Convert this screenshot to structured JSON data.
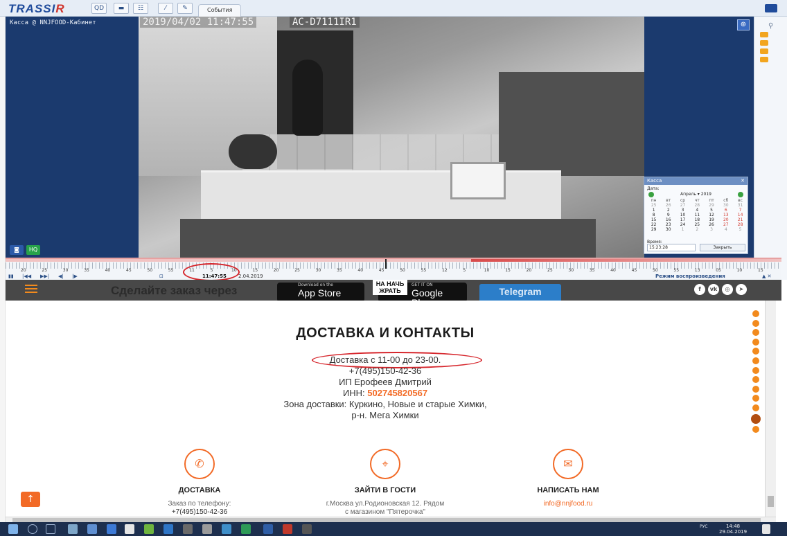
{
  "trassir": {
    "logo_main": "TRASSI",
    "logo_r": "R",
    "toolbar_buttons": [
      "QD",
      "▬",
      "☷",
      "⁄",
      "✎"
    ],
    "events_tab": "События",
    "camera_name": "Касса @ NNJFOOD-Кабинет",
    "osd_datetime": "2019/04/02 11:47:55",
    "osd_camera": "AC-D7111IR1",
    "zoom_icon": "zoom-in-icon",
    "hq_label": "HQ",
    "calendar": {
      "title": "Касса",
      "date_label": "Дата:",
      "month": "Апрель",
      "year": "2019",
      "weekdays": [
        "пн",
        "вт",
        "ср",
        "чт",
        "пт",
        "сб",
        "вс"
      ],
      "weeks": [
        [
          "25",
          "26",
          "27",
          "28",
          "29",
          "30",
          "31"
        ],
        [
          "1",
          "2",
          "3",
          "4",
          "5",
          "6",
          "7"
        ],
        [
          "8",
          "9",
          "10",
          "11",
          "12",
          "13",
          "14"
        ],
        [
          "15",
          "16",
          "17",
          "18",
          "19",
          "20",
          "21"
        ],
        [
          "22",
          "23",
          "24",
          "25",
          "26",
          "27",
          "28"
        ],
        [
          "29",
          "30",
          "1",
          "2",
          "3",
          "4",
          "5"
        ]
      ],
      "time_label": "Время:",
      "time_value": "15:23:28",
      "close_button": "Закрыть"
    },
    "timeline": {
      "tick_labels": [
        "20",
        "25",
        "30",
        "35",
        "40",
        "45",
        "50",
        "55",
        "11",
        "5",
        "10",
        "15",
        "20",
        "25",
        "30",
        "35",
        "40",
        "45",
        "50",
        "55",
        "12",
        "5",
        "10",
        "15",
        "20",
        "25",
        "30",
        "35",
        "40",
        "45",
        "50",
        "55",
        "13",
        "05",
        "10",
        "15"
      ],
      "current_time": "11:47:55",
      "date": "2.04.2019",
      "playback_mode": "Режим воспроизведения",
      "controls": [
        "▮▮",
        "|◀◀",
        "▶▶|",
        "◀|",
        "|▶"
      ]
    }
  },
  "banner": {
    "text": "Сделайте заказ через",
    "appstore_small": "Download on the",
    "appstore_big": "App Store",
    "logo_text": "НА НАЧЬ ЖРАТЬ",
    "google_small": "GET IT ON",
    "google_big": "Google Play",
    "telegram": "Telegram",
    "socials": [
      "f",
      "vk",
      "ig",
      "tg"
    ]
  },
  "page": {
    "title": "ДОСТАВКА И КОНТАКТЫ",
    "delivery_hours": "Доставка с 11-00 до 23-00.",
    "phone": "+7(495)150-42-36",
    "ip_name": "ИП Ерофеев Дмитрий",
    "inn_label": "ИНН:",
    "inn_value": "502745820567",
    "zone_line1": "Зона доставки: Куркино, Новые и старые Химки,",
    "zone_line2": "р-н. Мега Химки",
    "features": [
      {
        "title": "ДОСТАВКА",
        "line1": "Заказ по телефону:",
        "line2": "+7(495)150-42-36",
        "icon": "phone-icon"
      },
      {
        "title": "ЗАЙТИ В ГОСТИ",
        "line1": "г.Москва ул.Родионовская 12. Рядом",
        "line2": "с магазином \"Пятерочка\"",
        "icon": "location-pin-icon"
      },
      {
        "title": "НАПИСАТЬ НАМ",
        "line1": "info@nnjfood.ru",
        "line2": "",
        "icon": "envelope-icon"
      }
    ],
    "to_top": "↑"
  },
  "taskbar": {
    "tray_lang": "РУС",
    "tray_time": "14:48",
    "tray_date": "29.04.2019"
  },
  "colors": {
    "accent_orange": "#f26a26",
    "trassir_blue": "#1f4b9b",
    "annotation_red": "#d6252b"
  }
}
